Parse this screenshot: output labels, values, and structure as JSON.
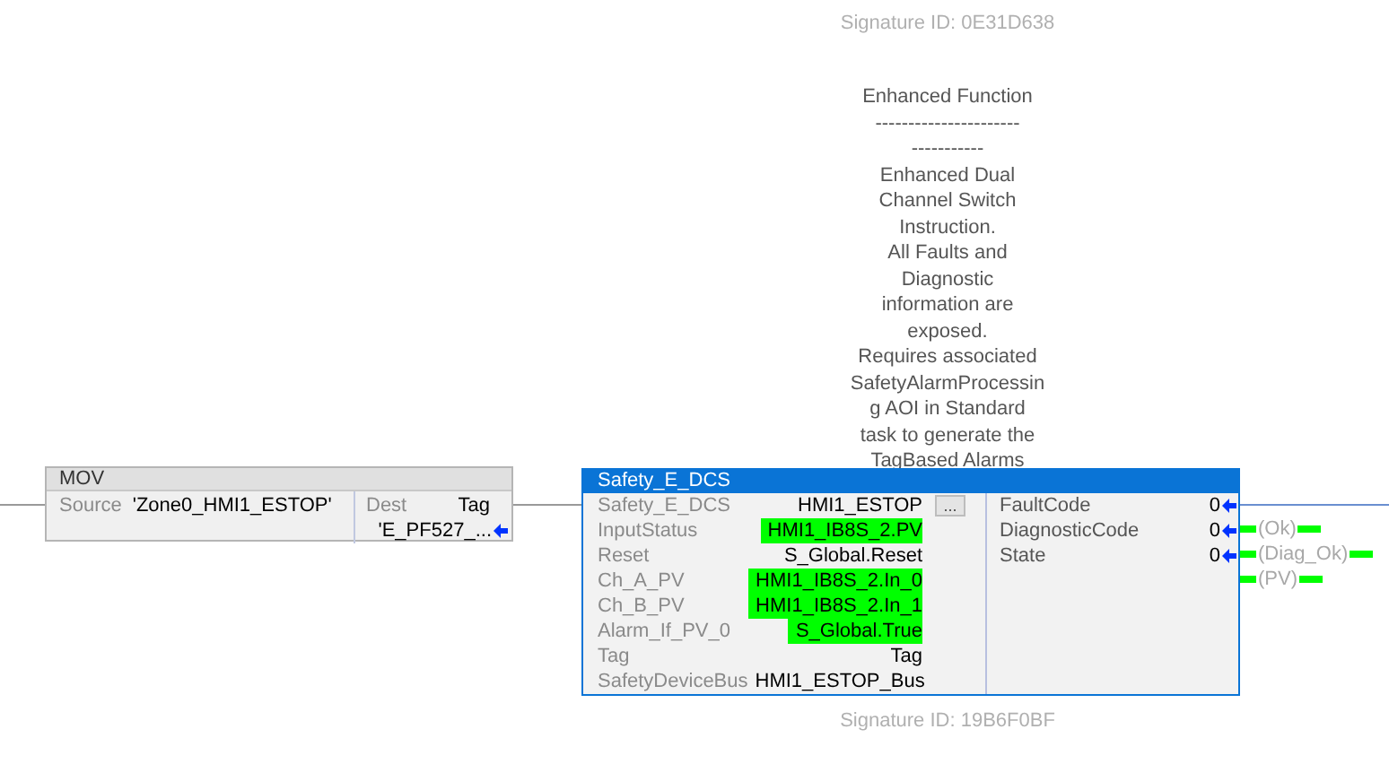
{
  "signature_top": "Signature ID: 0E31D638",
  "description": [
    "Enhanced Function",
    "----------------------",
    "-----------",
    "Enhanced Dual",
    "Channel Switch",
    "Instruction.",
    "All Faults and",
    "Diagnostic",
    "information are",
    "exposed.",
    "Requires associated",
    "SafetyAlarmProcessin",
    "g AOI in Standard",
    "task to generate the",
    "TagBased Alarms"
  ],
  "mov": {
    "title": "MOV",
    "source_label": "Source",
    "source_value": "'Zone0_HMI1_ESTOP'",
    "dest_label": "Dest",
    "dest_value": "Tag",
    "dest_tag": "'E_PF527_..."
  },
  "safety": {
    "title": "Safety_E_DCS",
    "selected": true,
    "inputs": [
      {
        "kind": "instance",
        "name": "Safety_E_DCS",
        "value": "HMI1_ESTOP",
        "button": "..."
      },
      {
        "kind": "param",
        "name": "InputStatus",
        "value": "HMI1_IB8S_2.PV",
        "highlighted": true
      },
      {
        "kind": "param",
        "name": "Reset",
        "value": "S_Global.Reset",
        "highlighted": false
      },
      {
        "kind": "param",
        "name": "Ch_A_PV",
        "value": "HMI1_IB8S_2.In_0",
        "highlighted": true
      },
      {
        "kind": "param",
        "name": "Ch_B_PV",
        "value": "HMI1_IB8S_2.In_1",
        "highlighted": true
      },
      {
        "kind": "param",
        "name": "Alarm_If_PV_0",
        "value": "S_Global.True",
        "highlighted": true
      },
      {
        "kind": "param",
        "name": "Tag",
        "value": "Tag",
        "highlighted": false
      },
      {
        "kind": "param",
        "name": "SafetyDeviceBus",
        "value": "HMI1_ESTOP_Bus",
        "highlighted": false
      }
    ],
    "outputs": [
      {
        "name": "FaultCode",
        "value": "0"
      },
      {
        "name": "DiagnosticCode",
        "value": "0"
      },
      {
        "name": "State",
        "value": "0"
      }
    ],
    "coils": [
      {
        "label": "(Ok)",
        "energized": true
      },
      {
        "label": "(Diag_Ok)",
        "energized": true
      },
      {
        "label": "(PV)",
        "energized": true
      }
    ]
  },
  "signature_bottom": "Signature ID: 19B6F0BF"
}
